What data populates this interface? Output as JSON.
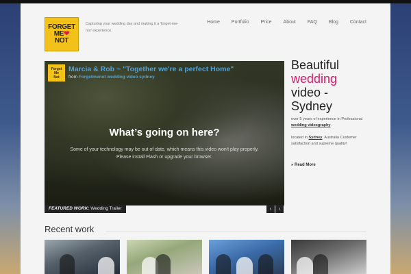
{
  "header": {
    "logo_lines": [
      "FORGET",
      "ME",
      "NOT"
    ],
    "tagline": "Capturing your wedding day and making it a 'forget-me-not' experience."
  },
  "nav": {
    "items": [
      "Home",
      "Portfolio",
      "Price",
      "About",
      "FAQ",
      "Blog",
      "Contact"
    ]
  },
  "video": {
    "title": "Marcia & Rob ~ \"Together we're a perfect Home\"",
    "from_prefix": "from",
    "from_channel": "Forgetmenot wedding video sydney",
    "logo_lines": [
      "Forget",
      "Me",
      "Not"
    ],
    "question": "What’s going on here?",
    "message": "Some of your technology may be out of date, which means this video won't play properly. Please install Flash or upgrade your browser.",
    "featured_label": "FEATURED WORK:",
    "featured_value": "Wedding Trailer",
    "prev": "‹",
    "next": "›"
  },
  "intro": {
    "line1": "Beautiful",
    "line2": "wedding",
    "line3": "video -",
    "line4": "Sydney",
    "desc_a": "over 5 years of experience in Professional",
    "desc_link": "wedding videography",
    "desc_b": ".",
    "loc_a": "located in",
    "loc_link": "Sydney",
    "loc_b": ", Australia Customer satisfaction and supreme quality!",
    "read_more": "» Read More"
  },
  "recent": {
    "title": "Recent work"
  },
  "colors": {
    "accent": "#e0166a",
    "link_blue": "#4aa3e0",
    "logo_yellow": "#f2c21b"
  }
}
